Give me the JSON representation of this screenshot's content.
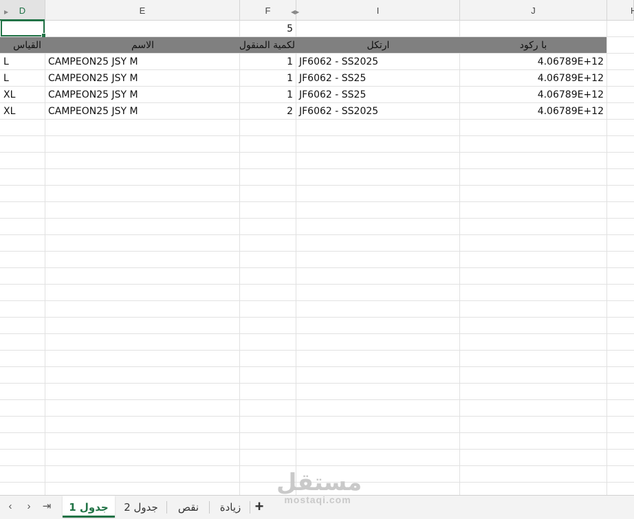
{
  "columns": [
    "D",
    "E",
    "F",
    "I",
    "J",
    "H"
  ],
  "cells": {
    "F29": "5"
  },
  "table": {
    "headers": {
      "size": "القياس",
      "name": "الاسم",
      "qty": "لكمية المنقول",
      "article": "ارتكل",
      "barcode": "با ركود"
    },
    "rows": [
      {
        "size": "L",
        "name": "CAMPEON25 JSY M",
        "qty": "1",
        "article": "JF6062 - SS2025",
        "barcode": "4.06789E+12"
      },
      {
        "size": "L",
        "name": "CAMPEON25 JSY M",
        "qty": "1",
        "article": "JF6062 - SS25",
        "barcode": "4.06789E+12"
      },
      {
        "size": "XL",
        "name": "CAMPEON25 JSY M",
        "qty": "1",
        "article": "JF6062 - SS25",
        "barcode": "4.06789E+12"
      },
      {
        "size": "XL",
        "name": "CAMPEON25 JSY M",
        "qty": "2",
        "article": "JF6062 - SS2025",
        "barcode": "4.06789E+12"
      }
    ]
  },
  "sheet_tabs": [
    {
      "label": "جدول 1",
      "active": true
    },
    {
      "label": "جدول 2",
      "active": false
    },
    {
      "label": "نقص",
      "active": false
    },
    {
      "label": "زيادة",
      "active": false
    }
  ],
  "watermark": {
    "logo": "مستقل",
    "site": "mostaqi.com"
  },
  "colors": {
    "accent": "#217346",
    "header_fill": "#808080",
    "grid": "#e1e1e1"
  }
}
